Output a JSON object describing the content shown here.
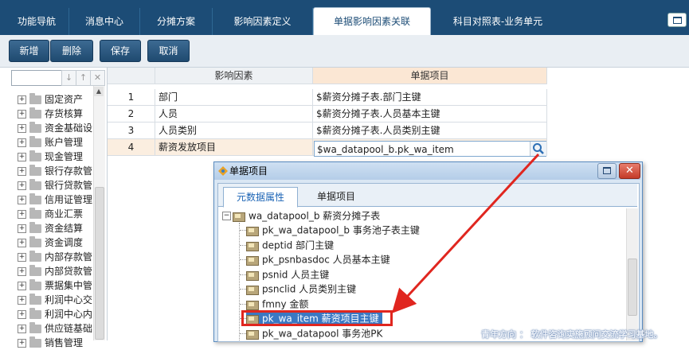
{
  "tabs": [
    "功能导航",
    "消息中心",
    "分摊方案",
    "影响因素定义",
    "单据影响因素关联",
    "科目对照表-业务单元"
  ],
  "active_tab": "单据影响因素关联",
  "toolbar": {
    "add": "新增",
    "delete": "删除",
    "save": "保存",
    "cancel": "取消"
  },
  "left_tree": {
    "items": [
      "固定资产",
      "存货核算",
      "资金基础设置",
      "账户管理",
      "现金管理",
      "银行存款管理",
      "银行贷款管理",
      "信用证管理",
      "商业汇票",
      "资金结算",
      "资金调度",
      "内部存款管理",
      "内部贷款管理",
      "票据集中管理",
      "利润中心交易",
      "利润中心内部",
      "供应链基础",
      "销售管理"
    ]
  },
  "grid": {
    "columns": [
      "影响因素",
      "单据项目"
    ],
    "rows": [
      {
        "num": "1",
        "factor": "部门",
        "item": "$薪资分摊子表.部门主键"
      },
      {
        "num": "2",
        "factor": "人员",
        "item": "$薪资分摊子表.人员基本主键"
      },
      {
        "num": "3",
        "factor": "人员类别",
        "item": "$薪资分摊子表.人员类别主键"
      },
      {
        "num": "4",
        "factor": "薪资发放项目",
        "item": "$wa_datapool_b.pk_wa_item"
      }
    ]
  },
  "dialog": {
    "title": "单据项目",
    "tabs": [
      "元数据属性",
      "单据项目"
    ],
    "active_tab": "元数据属性",
    "root": "wa_datapool_b  薪资分摊子表",
    "items": [
      "pk_wa_datapool_b  事务池子表主键",
      "deptid  部门主键",
      "pk_psnbasdoc  人员基本主键",
      "psnid  人员主键",
      "psnclid  人员类别主键",
      "fmny  金额",
      "pk_wa_item  薪资项目主键",
      "pk_wa_datapool  事务池PK"
    ],
    "highlighted_item": "pk_wa_item  薪资项目主键"
  },
  "watermark": "青年方向 ： 软件咨询实施顾问交流学习基地。",
  "colors": {
    "header": "#1c4c76",
    "highlight": "#e0261f",
    "selected_row": "#fbeee0"
  }
}
